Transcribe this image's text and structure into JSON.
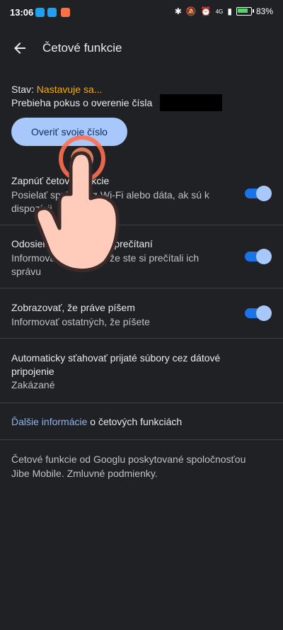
{
  "status_bar": {
    "time": "13:06",
    "battery": "83",
    "network": "4G"
  },
  "app_bar": {
    "title": "Četové funkcie"
  },
  "status": {
    "label": "Stav:",
    "value": "Nastavuje sa...",
    "description": "Prebieha pokus o overenie čísla"
  },
  "verify_button": {
    "label": "Overiť svoje číslo"
  },
  "settings": [
    {
      "title": "Zapnúť četové funkcie",
      "subtitle": "Posielať správy cez Wi-Fi alebo dáta, ak sú k dispozícii",
      "enabled": true
    },
    {
      "title": "Odosielať potvrdenia o prečítaní",
      "subtitle": "Informovať ostatných, že ste si prečítali ich správu",
      "enabled": true
    },
    {
      "title": "Zobrazovať, že práve píšem",
      "subtitle": "Informovať ostatných, že píšete",
      "enabled": true
    },
    {
      "title": "Automaticky sťahovať prijaté súbory cez dátové pripojenie",
      "subtitle": "Zakázané"
    }
  ],
  "learn_more": {
    "link": "Ďalšie informácie",
    "rest": " o četových funkciách"
  },
  "footer": {
    "text": "Četové funkcie od Googlu poskytované spoločnosťou Jibe Mobile. Zmluvné podmienky."
  },
  "colors": {
    "background": "#202124",
    "accent": "#a8c7fa",
    "status_orange": "#f9ab00",
    "link": "#8ab4f8"
  }
}
